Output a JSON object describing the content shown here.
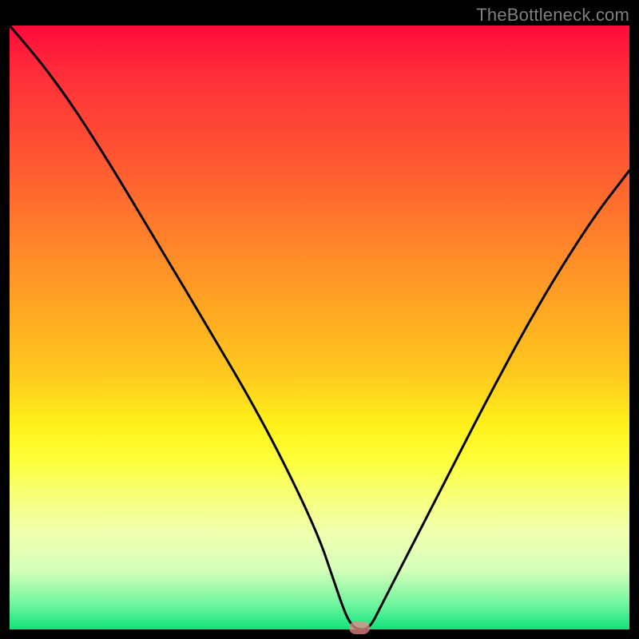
{
  "watermark": "TheBottleneck.com",
  "colors": {
    "frame": "#000000",
    "gradient_top": "#ff0a3a",
    "gradient_bottom": "#10e27a",
    "curve": "#000000",
    "marker": "#e88a8a",
    "watermark": "#808080"
  },
  "chart_data": {
    "type": "line",
    "title": "",
    "xlabel": "",
    "ylabel": "",
    "x_range": [
      0,
      100
    ],
    "y_range": [
      0,
      100
    ],
    "notes": "V-shaped bottleneck curve over a vertical red→green gradient. Minimum near x≈56 at y≈0. Left branch has an inflection near x≈18. A small pink marker sits at the vertex.",
    "series": [
      {
        "name": "bottleneck-curve",
        "x": [
          0,
          5,
          10,
          15,
          18,
          25,
          32,
          40,
          46,
          50,
          52,
          54,
          55,
          56,
          58,
          60,
          64,
          70,
          78,
          86,
          94,
          100
        ],
        "y": [
          100,
          94,
          87,
          79,
          74,
          62,
          50,
          36,
          24,
          15,
          9,
          3,
          1,
          0,
          0,
          4,
          12,
          24,
          40,
          55,
          68,
          76
        ]
      }
    ],
    "marker": {
      "x": 56.5,
      "y": 0
    }
  }
}
